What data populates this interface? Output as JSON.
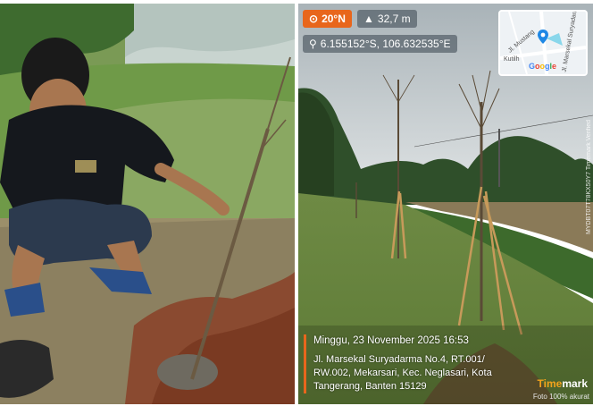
{
  "overlay": {
    "temperature": "20°N",
    "altitude": "32,7 m",
    "coordinates": "6.155152°S, 106.632535°E",
    "map": {
      "street_1": "Jl. Mustang",
      "street_2": "Jl. Marsekal Suryadarma",
      "street_3": "Kutilh",
      "logo": [
        "G",
        "o",
        "o",
        "g",
        "l",
        "e"
      ]
    },
    "datetime": "Minggu, 23 November 2025 16:53",
    "address": "Jl. Marsekal Suryadarma No.4, RT.001/ RW.002, Mekarsari, Kec. Neglasari, Kota Tangerang, Banten 15129",
    "brand": {
      "part1": "Time",
      "part2": "mark"
    },
    "verified": "Foto 100% akurat",
    "side_code": "MYDBT07T78KX50Y7  Timemark Verified"
  },
  "colors": {
    "accent": "#e8661c",
    "brand": "#f2a21c"
  }
}
